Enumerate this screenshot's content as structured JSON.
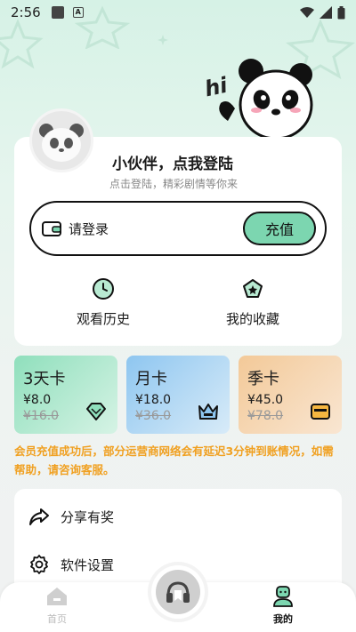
{
  "status_bar": {
    "time": "2:56"
  },
  "header": {
    "greeting": "hi"
  },
  "profile": {
    "title": "小伙伴，点我登陆",
    "subtitle": "点击登陆，精彩剧情等你来"
  },
  "wallet": {
    "label": "请登录",
    "recharge_label": "充值"
  },
  "quick_actions": [
    {
      "label": "观看历史",
      "icon": "history-icon"
    },
    {
      "label": "我的收藏",
      "icon": "favorite-icon"
    }
  ],
  "vip_cards": [
    {
      "name": "3天卡",
      "price": "¥8.0",
      "original": "¥16.0",
      "icon": "diamond-icon",
      "color": "#a8e6c8"
    },
    {
      "name": "月卡",
      "price": "¥18.0",
      "original": "¥36.0",
      "icon": "crown-icon",
      "color": "#a9d2f2"
    },
    {
      "name": "季卡",
      "price": "¥45.0",
      "original": "¥78.0",
      "icon": "card-icon",
      "color": "#f6d7b2"
    }
  ],
  "notice": "会员充值成功后，部分运营商网络会有延迟3分钟到账情况，如需帮助，请咨询客服。",
  "menu": [
    {
      "label": "分享有奖",
      "icon": "share-icon"
    },
    {
      "label": "软件设置",
      "icon": "settings-icon"
    }
  ],
  "tabbar": {
    "home_label": "首页",
    "mine_label": "我的"
  },
  "colors": {
    "accent": "#7cd6b0",
    "notice": "#f0a020"
  }
}
